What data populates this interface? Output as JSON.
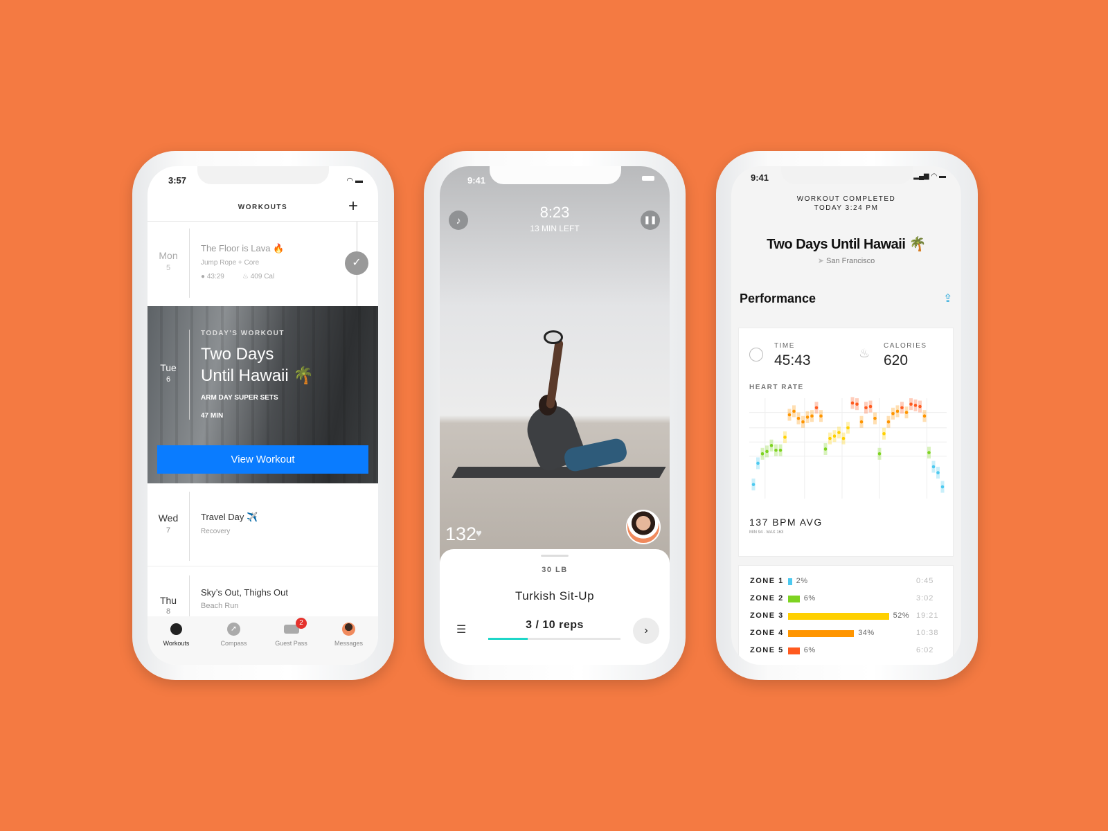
{
  "colors": {
    "background": "#F47A42",
    "accent_blue": "#0A7CFF",
    "progress_teal": "#1ED6C8",
    "share_blue": "#1AA3D9",
    "badge_red": "#E5322D"
  },
  "left_phone": {
    "status_time": "3:57",
    "header": {
      "title": "WORKOUTS",
      "add_icon": "plus-icon"
    },
    "workouts": [
      {
        "day": "Mon",
        "date": "5",
        "title": "The Floor is Lava 🔥",
        "subtitle": "Jump Rope + Core",
        "duration": "43:29",
        "calories": "409 Cal",
        "completed": true
      },
      {
        "day": "Tue",
        "date": "6",
        "eyebrow": "TODAY'S WORKOUT",
        "title_line1": "Two Days",
        "title_line2": "Until Hawaii 🌴",
        "subtitle": "ARM DAY SUPER SETS",
        "duration": "47 MIN",
        "button": "View Workout"
      },
      {
        "day": "Wed",
        "date": "7",
        "title": "Travel Day ✈️",
        "subtitle": "Recovery"
      },
      {
        "day": "Thu",
        "date": "8",
        "title": "Sky’s Out, Thighs Out",
        "subtitle": "Beach Run"
      }
    ],
    "tabs": [
      {
        "label": "Workouts",
        "icon": "stopwatch-icon",
        "active": true
      },
      {
        "label": "Compass",
        "icon": "compass-icon"
      },
      {
        "label": "Guest Pass",
        "icon": "ticket-icon",
        "badge": "2"
      },
      {
        "label": "Messages",
        "icon": "avatar-icon"
      }
    ]
  },
  "middle_phone": {
    "status_time": "9:41",
    "timer": "8:23",
    "time_left": "13 MIN LEFT",
    "heart_rate": "132",
    "weight": "30 LB",
    "exercise": "Turkish Sit-Up",
    "reps": "3 / 10 reps",
    "reps_progress": 0.3
  },
  "right_phone": {
    "status_time": "9:41",
    "completed_label": "WORKOUT COMPLETED",
    "completed_time": "TODAY 3:24 PM",
    "title": "Two Days Until Hawaii 🌴",
    "location": "San Francisco",
    "section": "Performance",
    "time_label": "TIME",
    "time_value": "45:43",
    "calories_label": "CALORIES",
    "calories_value": "620",
    "heart_rate_label": "HEART RATE",
    "avg": "137 BPM AVG",
    "minmax": "MIN 94 · MAX 163",
    "zones": [
      {
        "label": "ZONE 1",
        "pct": 2,
        "pct_label": "2%",
        "time": "0:45",
        "color": "#4CC9F0"
      },
      {
        "label": "ZONE 2",
        "pct": 6,
        "pct_label": "6%",
        "time": "3:02",
        "color": "#7ED321"
      },
      {
        "label": "ZONE 3",
        "pct": 52,
        "pct_label": "52%",
        "time": "19:21",
        "color": "#FFD000"
      },
      {
        "label": "ZONE 4",
        "pct": 34,
        "pct_label": "34%",
        "time": "10:38",
        "color": "#FF9500"
      },
      {
        "label": "ZONE 5",
        "pct": 6,
        "pct_label": "6%",
        "time": "6:02",
        "color": "#FF5A1F"
      }
    ]
  },
  "chart_data": {
    "type": "scatter",
    "title": "HEART RATE",
    "ylabel": "",
    "xlabel": "",
    "grid": true,
    "ylim": [
      85,
      170
    ],
    "unit": "bpm",
    "values": [
      94,
      112,
      120,
      122,
      127,
      123,
      123,
      134,
      153,
      156,
      150,
      147,
      151,
      152,
      159,
      152,
      124,
      133,
      135,
      138,
      133,
      142,
      163,
      162,
      147,
      159,
      160,
      150,
      120,
      137,
      147,
      154,
      156,
      159,
      155,
      162,
      161,
      160,
      152,
      121,
      109,
      104,
      92
    ],
    "zones": [
      1,
      1,
      2,
      2,
      2,
      2,
      2,
      3,
      4,
      4,
      4,
      4,
      4,
      4,
      5,
      4,
      2,
      3,
      3,
      3,
      3,
      3,
      5,
      5,
      4,
      5,
      5,
      4,
      2,
      3,
      4,
      4,
      4,
      5,
      4,
      5,
      5,
      5,
      4,
      2,
      1,
      1,
      1
    ]
  }
}
